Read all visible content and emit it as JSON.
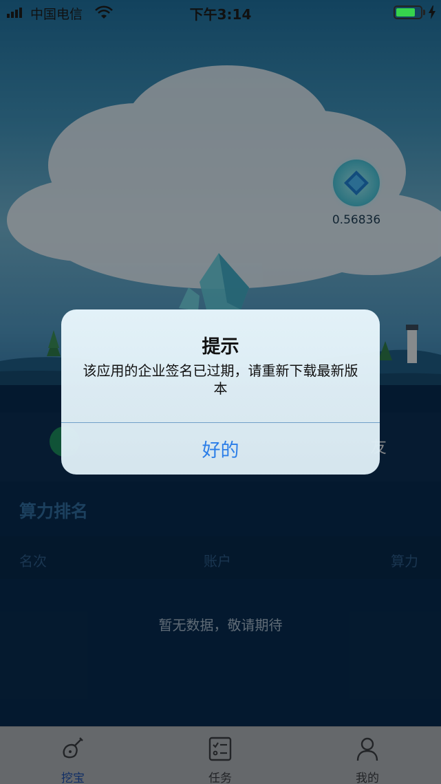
{
  "status_bar": {
    "carrier": "中国电信",
    "time": "下午3:14",
    "battery_level": 0.8,
    "signal_icon": "cellular-signal-icon",
    "wifi_icon": "wifi-icon",
    "battery_icon": "battery-icon",
    "charging_icon": "charging-bolt-icon"
  },
  "gem_balance": {
    "icon": "blue-gem-icon",
    "value": "0.56836"
  },
  "hidden_behind_dialog": {
    "right_text": "友"
  },
  "ranking": {
    "title": "算力排名",
    "columns": [
      "名次",
      "账户",
      "算力"
    ],
    "empty_message": "暂无数据，敬请期待"
  },
  "tabbar": {
    "items": [
      {
        "label": "挖宝",
        "icon": "shovel-icon",
        "active": true
      },
      {
        "label": "任务",
        "icon": "task-list-icon",
        "active": false
      },
      {
        "label": "我的",
        "icon": "user-profile-icon",
        "active": false
      }
    ]
  },
  "alert": {
    "title": "提示",
    "message": "该应用的企业签名已过期，请重新下载最新版本",
    "button": "好的"
  },
  "colors": {
    "alert_button": "#2a7de8",
    "active_tab": "#1c4ea8",
    "battery_fill": "#36d44d"
  }
}
